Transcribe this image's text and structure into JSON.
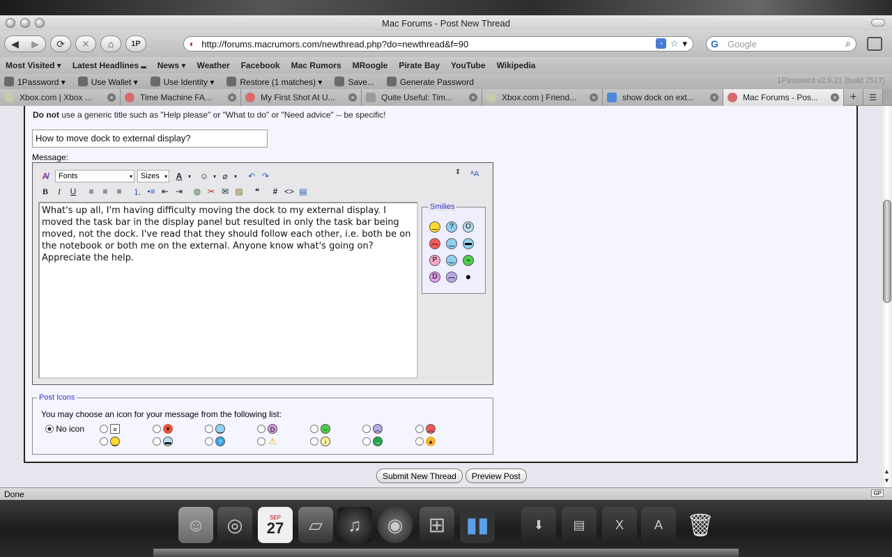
{
  "window": {
    "title": "Mac Forums - Post New Thread"
  },
  "nav": {
    "back": "◀",
    "forward": "▶",
    "reload": "⟳",
    "stop": "✕",
    "home": "⌂",
    "onepassword": "1P",
    "url": "http://forums.macrumors.com/newthread.php?do=newthread&f=90",
    "search_placeholder": "Google"
  },
  "bookmarks": [
    {
      "label": "Most Visited ▾"
    },
    {
      "label": "Latest Headlines ⑉"
    },
    {
      "label": "News ▾"
    },
    {
      "label": "Weather"
    },
    {
      "label": "Facebook"
    },
    {
      "label": "Mac Rumors"
    },
    {
      "label": "MRoogle"
    },
    {
      "label": "Pirate Bay"
    },
    {
      "label": "YouTube"
    },
    {
      "label": "Wikipedia"
    }
  ],
  "onepassword_bar": {
    "items": [
      "1Password ▾",
      "Use Wallet ▾",
      "Use Identity ▾",
      "Restore (1 matches) ▾",
      "Save...",
      "Generate Password"
    ],
    "version": "1Password v2.9.21 (build 7517)"
  },
  "tabs": [
    {
      "label": "Xbox.com | Xbox ..."
    },
    {
      "label": "Time Machine FA..."
    },
    {
      "label": "My First Shot At U..."
    },
    {
      "label": "Quite Useful: Tim..."
    },
    {
      "label": "Xbox.com | Friend..."
    },
    {
      "label": "show dock on ext..."
    },
    {
      "label": "Mac Forums - Pos..."
    }
  ],
  "form": {
    "hint_bold": "Do not",
    "hint_rest": " use a generic title such as \"Help please\" or \"What to do\" or \"Need advice\" -- be specific!",
    "title_value": "How to move dock to external display?",
    "message_label": "Message:",
    "fonts_select": "Fonts",
    "sizes_select": "Sizes",
    "message_text": "What's up all, I'm having difficulty moving the dock to my external display.  I moved the task bar in the display panel but resulted in only the task bar being moved, not the dock.  I've read that they should follow each other, i.e. both be on the notebook or both me on the external. Anyone know what's going on? Appreciate the help.",
    "smilies_legend": "Smilies",
    "post_icons_legend": "Post Icons",
    "post_icons_desc": "You may choose an icon for your message from the following list:",
    "no_icon_label": "No icon",
    "submit_label": "Submit New Thread",
    "preview_label": "Preview Post"
  },
  "status": {
    "text": "Done",
    "badge": "GP"
  },
  "dock": {
    "calendar_month": "SEP",
    "calendar_day": "27"
  },
  "colors": {
    "page_bg": "#e6e6ef",
    "panel_bg": "#f5f5ff",
    "legend_text": "#3333cc"
  }
}
